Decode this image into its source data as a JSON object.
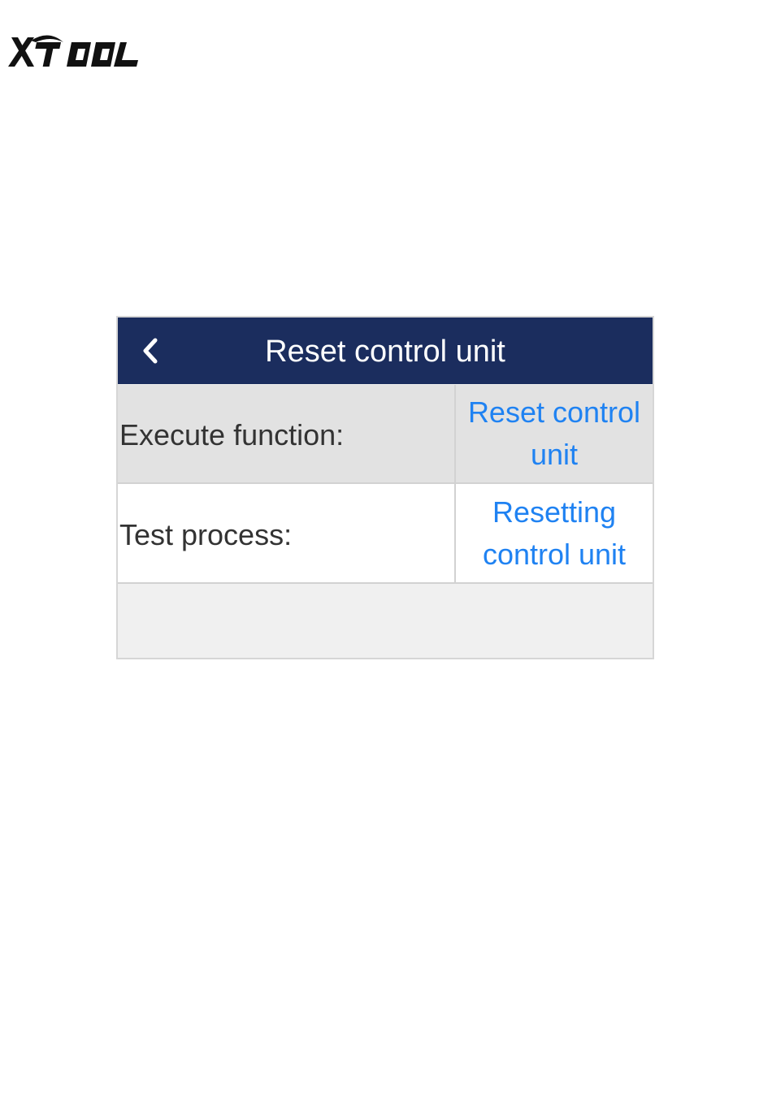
{
  "brand": {
    "logo_text": "XTOOL"
  },
  "header": {
    "title": "Reset control unit",
    "back_icon": "chevron-left-icon",
    "background_color": "#1b2d5e"
  },
  "rows": [
    {
      "label": "Execute function:",
      "value": "Reset control unit"
    },
    {
      "label": "Test process:",
      "value": "Resetting control unit"
    }
  ],
  "colors": {
    "value_text": "#1f82f2",
    "label_text": "#333333"
  }
}
